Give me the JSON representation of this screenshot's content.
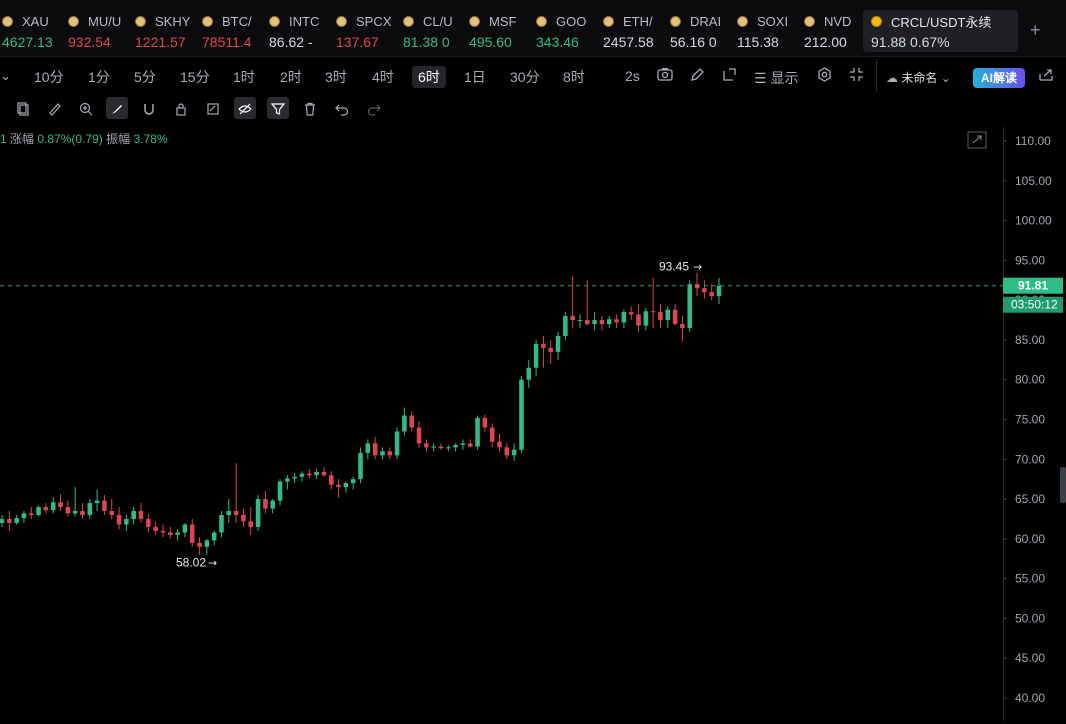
{
  "tickers": [
    {
      "symbol": "XAU",
      "price": "4627.13",
      "dir": "up"
    },
    {
      "symbol": "MU/U",
      "price": "932.54",
      "dir": "down"
    },
    {
      "symbol": "SKHY",
      "price": "1221.57",
      "dir": "down"
    },
    {
      "symbol": "BTC/",
      "price": "78511.4",
      "dir": "down"
    },
    {
      "symbol": "INTC",
      "price": "86.62 -",
      "dir": "flat"
    },
    {
      "symbol": "SPCX",
      "price": "137.67",
      "dir": "down"
    },
    {
      "symbol": "CL/U",
      "price": "81.38 0",
      "dir": "up"
    },
    {
      "symbol": "MSF",
      "price": "495.60",
      "dir": "up"
    },
    {
      "symbol": "GOO",
      "price": "343.46",
      "dir": "up"
    },
    {
      "symbol": "ETH/",
      "price": "2457.58",
      "dir": "flat"
    },
    {
      "symbol": "DRAI",
      "price": "56.16 0",
      "dir": "flat"
    },
    {
      "symbol": "SOXI",
      "price": "115.38",
      "dir": "flat"
    },
    {
      "symbol": "NVD",
      "price": "212.00",
      "dir": "flat"
    }
  ],
  "active_ticker": {
    "symbol": "CRCL/USDT永续",
    "price": "91.88",
    "change": "0.67%"
  },
  "timeframes": [
    "10分",
    "1分",
    "5分",
    "15分",
    "1时",
    "2时",
    "3时",
    "4时",
    "6时",
    "1日",
    "30分",
    "8时"
  ],
  "active_timeframe": "6时",
  "toolbar": {
    "refresh": "2s",
    "indicators_label": "显示",
    "layout_name": "未命名",
    "ai_label": "AI解读"
  },
  "info": {
    "prefix": "1",
    "change_label": "涨幅",
    "change_value": "0.87%(0.79)",
    "amp_label": "振幅",
    "amp_value": "3.78%"
  },
  "colors": {
    "up": "#2ebd85",
    "down": "#e0444f",
    "accent": "#2ebd85"
  },
  "chart_data": {
    "type": "candlestick",
    "ylim": [
      38,
      112
    ],
    "y_ticks": [
      "110.00",
      "105.00",
      "100.00",
      "95.00",
      "90.00",
      "85.00",
      "80.00",
      "75.00",
      "70.00",
      "65.00",
      "60.00",
      "55.00",
      "50.00",
      "45.00",
      "40.00"
    ],
    "y_tick_values": [
      110,
      105,
      100,
      95,
      90,
      85,
      80,
      75,
      70,
      65,
      60,
      55,
      50,
      45,
      40
    ],
    "last_price": "91.81",
    "last_price_value": 91.81,
    "countdown": "03:50:12",
    "high_label": "93.45",
    "high_value": 93.45,
    "low_label": "58.02",
    "low_value": 58.02,
    "candles": [
      [
        62.0,
        63.0,
        61.5,
        62.5
      ],
      [
        62.5,
        63.5,
        61.0,
        62.0
      ],
      [
        62.0,
        63.0,
        61.8,
        62.6
      ],
      [
        62.6,
        63.5,
        62.0,
        63.2
      ],
      [
        63.2,
        64.0,
        62.5,
        63.0
      ],
      [
        63.0,
        64.2,
        62.8,
        64.0
      ],
      [
        64.0,
        64.5,
        63.2,
        63.6
      ],
      [
        63.6,
        65.2,
        63.2,
        64.6
      ],
      [
        64.6,
        65.6,
        63.5,
        64.0
      ],
      [
        64.0,
        64.8,
        62.8,
        63.2
      ],
      [
        63.2,
        66.5,
        62.8,
        63.5
      ],
      [
        63.5,
        64.5,
        62.5,
        63.0
      ],
      [
        63.0,
        65.0,
        62.5,
        64.5
      ],
      [
        64.5,
        66.2,
        63.5,
        64.8
      ],
      [
        64.8,
        65.5,
        63.0,
        63.5
      ],
      [
        63.5,
        65.0,
        62.5,
        63.0
      ],
      [
        63.0,
        64.0,
        61.2,
        61.8
      ],
      [
        61.8,
        63.0,
        61.0,
        62.5
      ],
      [
        62.5,
        64.0,
        61.8,
        63.5
      ],
      [
        63.5,
        64.5,
        62.0,
        62.5
      ],
      [
        62.5,
        63.2,
        60.8,
        61.5
      ],
      [
        61.5,
        62.2,
        60.5,
        61.0
      ],
      [
        61.0,
        61.8,
        60.2,
        60.8
      ],
      [
        60.8,
        61.5,
        60.0,
        60.5
      ],
      [
        60.5,
        61.2,
        59.8,
        60.8
      ],
      [
        60.8,
        62.0,
        60.2,
        61.8
      ],
      [
        61.8,
        62.5,
        59.0,
        59.5
      ],
      [
        59.5,
        60.2,
        58.0,
        59.0
      ],
      [
        59.0,
        60.0,
        58.02,
        59.8
      ],
      [
        59.8,
        61.0,
        59.2,
        60.8
      ],
      [
        60.8,
        63.5,
        60.2,
        63.0
      ],
      [
        63.0,
        65.0,
        62.0,
        63.5
      ],
      [
        63.5,
        69.5,
        62.0,
        63.0
      ],
      [
        63.0,
        63.8,
        61.5,
        62.2
      ],
      [
        62.2,
        64.0,
        60.5,
        61.5
      ],
      [
        61.5,
        65.5,
        61.0,
        65.0
      ],
      [
        65.0,
        66.0,
        63.2,
        63.8
      ],
      [
        63.8,
        65.0,
        63.2,
        64.8
      ],
      [
        64.8,
        67.5,
        64.2,
        67.2
      ],
      [
        67.2,
        68.0,
        66.2,
        67.6
      ],
      [
        67.6,
        68.3,
        67.0,
        67.8
      ],
      [
        67.8,
        68.5,
        67.2,
        68.2
      ],
      [
        68.2,
        68.8,
        67.6,
        68.0
      ],
      [
        68.0,
        68.8,
        67.5,
        68.4
      ],
      [
        68.4,
        69.0,
        67.8,
        68.0
      ],
      [
        68.0,
        68.5,
        66.2,
        66.8
      ],
      [
        66.8,
        67.5,
        65.2,
        66.5
      ],
      [
        66.5,
        67.2,
        65.8,
        67.0
      ],
      [
        67.0,
        67.8,
        66.2,
        67.5
      ],
      [
        67.5,
        71.5,
        67.0,
        70.8
      ],
      [
        70.8,
        72.5,
        70.0,
        72.0
      ],
      [
        72.0,
        72.8,
        70.0,
        70.5
      ],
      [
        70.5,
        71.5,
        70.0,
        71.0
      ],
      [
        71.0,
        71.5,
        70.0,
        70.5
      ],
      [
        70.5,
        74.0,
        70.0,
        73.5
      ],
      [
        73.5,
        76.5,
        73.0,
        75.5
      ],
      [
        75.5,
        76.0,
        73.5,
        74.0
      ],
      [
        74.0,
        74.8,
        71.5,
        72.0
      ],
      [
        72.0,
        72.5,
        71.0,
        71.5
      ],
      [
        71.5,
        72.0,
        71.0,
        71.6
      ],
      [
        71.6,
        72.0,
        71.2,
        71.4
      ],
      [
        71.4,
        71.8,
        71.0,
        71.5
      ],
      [
        71.5,
        72.0,
        71.0,
        71.8
      ],
      [
        71.8,
        72.5,
        71.2,
        72.0
      ],
      [
        72.0,
        72.5,
        71.5,
        71.6
      ],
      [
        71.6,
        75.5,
        71.2,
        75.2
      ],
      [
        75.2,
        75.6,
        73.5,
        74.0
      ],
      [
        74.0,
        74.5,
        71.5,
        72.2
      ],
      [
        72.2,
        73.2,
        71.0,
        71.5
      ],
      [
        71.5,
        72.0,
        70.0,
        70.5
      ],
      [
        70.5,
        72.0,
        69.8,
        71.2
      ],
      [
        71.2,
        80.5,
        70.8,
        80.0
      ],
      [
        80.0,
        82.5,
        79.0,
        81.5
      ],
      [
        81.5,
        85.0,
        80.5,
        84.5
      ],
      [
        84.5,
        85.5,
        81.5,
        84.0
      ],
      [
        84.0,
        85.0,
        82.0,
        83.5
      ],
      [
        83.5,
        86.0,
        82.5,
        85.5
      ],
      [
        85.5,
        88.5,
        85.0,
        88.0
      ],
      [
        88.0,
        93.0,
        86.5,
        87.5
      ],
      [
        87.5,
        88.2,
        86.5,
        87.5
      ],
      [
        87.5,
        92.5,
        86.8,
        87.0
      ],
      [
        87.0,
        88.5,
        86.2,
        87.5
      ],
      [
        87.5,
        88.0,
        86.2,
        87.0
      ],
      [
        87.0,
        88.0,
        86.5,
        87.6
      ],
      [
        87.6,
        88.2,
        86.5,
        87.2
      ],
      [
        87.2,
        88.8,
        86.5,
        88.5
      ],
      [
        88.5,
        89.2,
        87.5,
        88.2
      ],
      [
        88.2,
        89.5,
        86.0,
        86.8
      ],
      [
        86.8,
        89.0,
        86.2,
        88.6
      ],
      [
        88.6,
        92.8,
        86.5,
        88.5
      ],
      [
        88.5,
        89.5,
        86.5,
        87.5
      ],
      [
        87.5,
        89.2,
        86.5,
        88.8
      ],
      [
        88.8,
        89.5,
        86.8,
        87.0
      ],
      [
        87.0,
        88.0,
        84.8,
        86.5
      ],
      [
        86.5,
        92.5,
        86.0,
        92.0
      ],
      [
        92.0,
        93.45,
        90.5,
        91.5
      ],
      [
        91.5,
        92.5,
        90.2,
        91.0
      ],
      [
        91.0,
        92.0,
        90.0,
        90.5
      ],
      [
        90.5,
        92.8,
        89.5,
        91.81
      ]
    ]
  }
}
